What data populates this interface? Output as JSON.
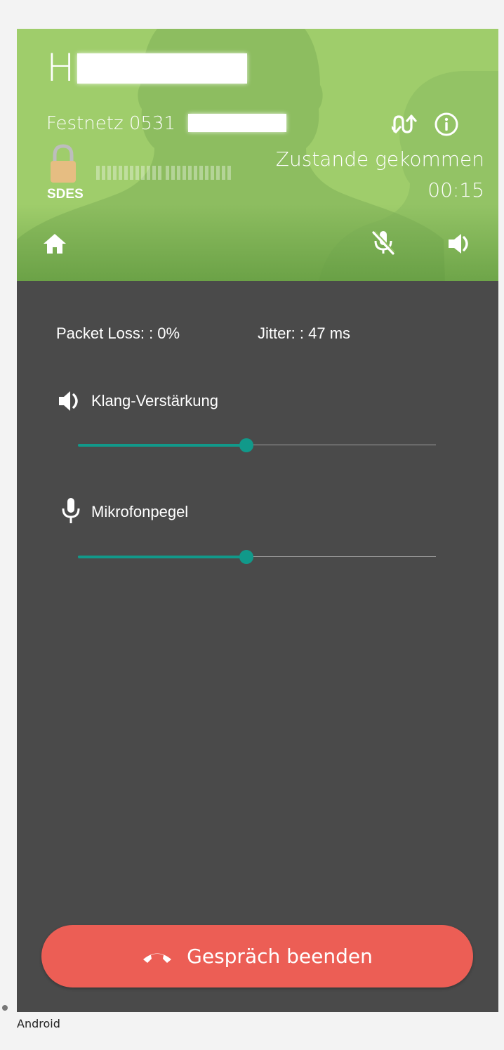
{
  "header": {
    "contact_initial": "H",
    "line_label": "Festnetz 0531",
    "encryption_label": "SDES",
    "status": "Zustande gekommen",
    "timer": "00:15",
    "background_color": "#9fcd6b"
  },
  "icons": {
    "swap": "swap-calls-icon",
    "info": "info-icon",
    "lock": "lock-icon",
    "home": "home-icon",
    "mute": "mic-off-icon",
    "speaker": "speaker-icon",
    "volume": "volume-icon",
    "microphone": "microphone-icon",
    "hang_up": "phone-hangup-icon"
  },
  "stats": {
    "packet_loss": "Packet Loss: : 0%",
    "jitter": "Jitter: : 47 ms"
  },
  "controls": {
    "gain": {
      "label": "Klang-Verstärkung",
      "value": 0.47
    },
    "microphone": {
      "label": "Mikrofonpegel",
      "value": 0.47
    },
    "accent_color": "#11998a"
  },
  "end_call": {
    "label": "Gespräch beenden",
    "color": "#ec5e55"
  },
  "caption": "Android"
}
